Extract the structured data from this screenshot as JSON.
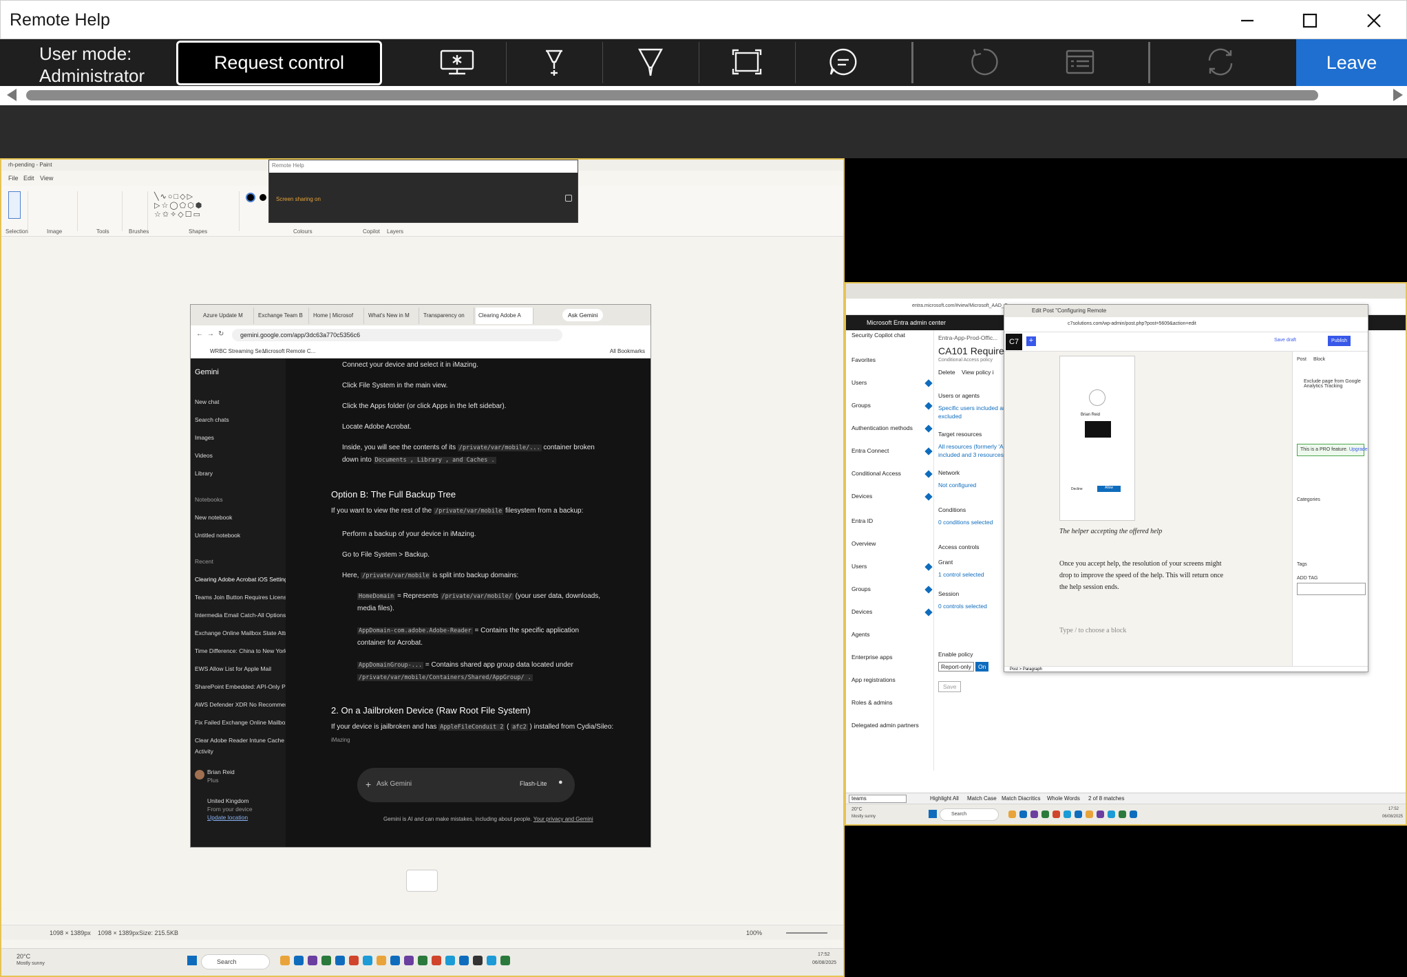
{
  "window": {
    "title": "Remote Help"
  },
  "toolbar": {
    "user_mode": "User mode:",
    "user_role": "Administrator",
    "request_control": "Request control",
    "leave": "Leave"
  },
  "paint": {
    "title": "rh-pending - Paint",
    "menu": [
      "File",
      "Edit",
      "View"
    ],
    "ribbon_groups": [
      "Selection",
      "Image",
      "Tools",
      "Brushes",
      "Shapes",
      "Colours",
      "Copilot",
      "Layers"
    ],
    "status": {
      "size1": "1098 × 1389px",
      "size2": "1098 × 1389px",
      "filesize": "Size: 215.5KB",
      "zoom": "100%"
    }
  },
  "remote_help_mini": {
    "title": "Remote Help",
    "status": "Screen sharing on"
  },
  "gemini": {
    "tabs": [
      "Azure Update M",
      "Exchange Team B",
      "Home | Microsof",
      "What's New in M",
      "Transparency on",
      "Clearing Adobe A"
    ],
    "ask_gemini_btn": "Ask Gemini",
    "url": "gemini.google.com/app/3dc63a770c5356c6",
    "bookmarks": [
      "WRBC Streaming Se...",
      "Microsoft Remote C...",
      "All Bookmarks"
    ],
    "app_name": "Gemini",
    "nav": [
      "New chat",
      "Search chats",
      "Images",
      "Videos",
      "Library"
    ],
    "notebooks_header": "Notebooks",
    "notebooks": [
      "New notebook",
      "Untitled notebook"
    ],
    "recent_header": "Recent",
    "recent": [
      "Clearing Adobe Acrobat iOS Settings",
      "Teams Join Button Requires License",
      "Intermedia Email Catch-All Options Exp...",
      "Exchange Online Mailbox State Attribut...",
      "Time Difference: China to New York",
      "EWS Allow List for Apple Mail",
      "SharePoint Embedded: API-Only Platfo...",
      "AWS Defender XDR No Recommendati...",
      "Fix Failed Exchange Online Mailbox Mig...",
      "Clear Adobe Reader Intune Cache"
    ],
    "activity": "Activity",
    "user_name": "Brian Reid",
    "user_plan": "Plus",
    "location": "United Kingdom",
    "location_sub": "From your device",
    "update_location": "Update location",
    "content": {
      "step1": "Connect your device and select it in iMazing.",
      "step2": "Click File System in the main view.",
      "step3": "Click the Apps folder (or click Apps in the left sidebar).",
      "step4": "Locate Adobe Acrobat.",
      "step5a": "Inside, you will see the contents of its",
      "step5code": "/private/var/mobile/...",
      "step5b": "container broken",
      "step5c": "down into",
      "step5d": "Documents , Library , and Caches .",
      "optionB": "Option B: The Full Backup Tree",
      "optionB_intro": "If you want to view the rest of the",
      "optionB_code": "/private/var/mobile",
      "optionB_intro2": "filesystem from a backup:",
      "b1": "Perform a backup of your device in iMazing.",
      "b2": "Go to File System > Backup.",
      "b3a": "Here,",
      "b3code": "/private/var/mobile",
      "b3b": "is split into backup domains:",
      "d1code": "HomeDomain",
      "d1a": "= Represents",
      "d1code2": "/private/var/mobile/",
      "d1b": "(your user data, downloads,",
      "d1c": "media files).",
      "d2code": "AppDomain-com.adobe.Adobe-Reader",
      "d2a": "= Contains the specific application",
      "d2b": "container for Acrobat.",
      "d3code": "AppDomainGroup-...",
      "d3a": "= Contains shared app group data located under",
      "d3code2": "/private/var/mobile/Containers/Shared/AppGroup/ .",
      "section2": "2. On a Jailbroken Device (Raw Root File System)",
      "s2a": "If your device is jailbroken and has",
      "s2code": "AppleFileConduit 2",
      "s2code2": "afc2",
      "s2b": "installed from Cydia/Sileo:",
      "imazing": "iMazing"
    },
    "input_placeholder": "Ask Gemini",
    "model": "Flash-Lite",
    "disclaimer": "Gemini is AI and can make mistakes, including about people.",
    "disclaimer_link": "Your privacy and Gemini"
  },
  "entra": {
    "url": "entra.microsoft.com/#view/Microsoft_AAD_Co...",
    "header": "Microsoft Entra admin center",
    "copilot": "Security Copilot chat",
    "nav": [
      "Favorites",
      "Users",
      "Groups",
      "Authentication methods",
      "Entra Connect",
      "Conditional Access",
      "Devices",
      "Entra ID",
      "Overview",
      "Users",
      "Groups",
      "Devices",
      "Agents",
      "Enterprise apps",
      "App registrations",
      "Roles & admins",
      "Delegated admin partners"
    ],
    "breadcrumb": "Entra-App-Prod-Offic...",
    "policy_title": "CA101 Require m",
    "policy_sub": "Conditional Access policy",
    "delete": "Delete",
    "view_policy": "View policy i",
    "users_agents": "Users or agents",
    "users_value": "Specific users included and sp",
    "users_value2": "excluded",
    "target_resources": "Target resources",
    "target_value": "All resources (formerly 'All cl",
    "target_value2": "included and 3 resources excl",
    "network": "Network",
    "network_value": "Not configured",
    "conditions": "Conditions",
    "conditions_value": "0 conditions selected",
    "access_controls": "Access controls",
    "grant": "Grant",
    "grant_value": "1 control selected",
    "session": "Session",
    "session_value": "0 controls selected",
    "enable_policy": "Enable policy",
    "report_only": "Report-only",
    "on": "On",
    "save": "Save",
    "find": "teams",
    "find_opts": [
      "Highlight All",
      "Match Case",
      "Match Diacritics",
      "Whole Words"
    ],
    "find_count": "2 of 8 matches"
  },
  "wordpress": {
    "tab": "Edit Post \"Configuring Remote",
    "url": "c7solutions.com/wp-admin/post.php?post=5609&action=edit",
    "save_draft": "Save draft",
    "publish": "Publish",
    "caption": "The helper accepting the offered help",
    "paragraph": "Once you accept help, the resolution  of your screens might drop to improve the speed of the help. This will return once the help session ends.",
    "block_placeholder": "Type / to choose a block",
    "sidebar_tabs": [
      "Post",
      "Block"
    ],
    "exclude_ga": "Exclude page from Google Analytics Tracking",
    "pro_feature": "This is a PRO feature.",
    "upgrade": "Upgrade",
    "categories": "Categories",
    "tags": "Tags",
    "add_tag": "ADD TAG",
    "breadcrumb": "Post > Paragraph",
    "mini_name": "Brian Reid",
    "mini_decline": "Decline",
    "mini_allow": "Allow"
  },
  "taskbar": {
    "weather_temp": "20°C",
    "weather_desc": "Mostly sunny",
    "search": "Search",
    "time": "17:52",
    "date": "06/08/2025"
  },
  "colors": {
    "accent": "#1e6fd0",
    "border_highlight": "#e6c453",
    "toolbar_bg": "#1f1f1f"
  }
}
